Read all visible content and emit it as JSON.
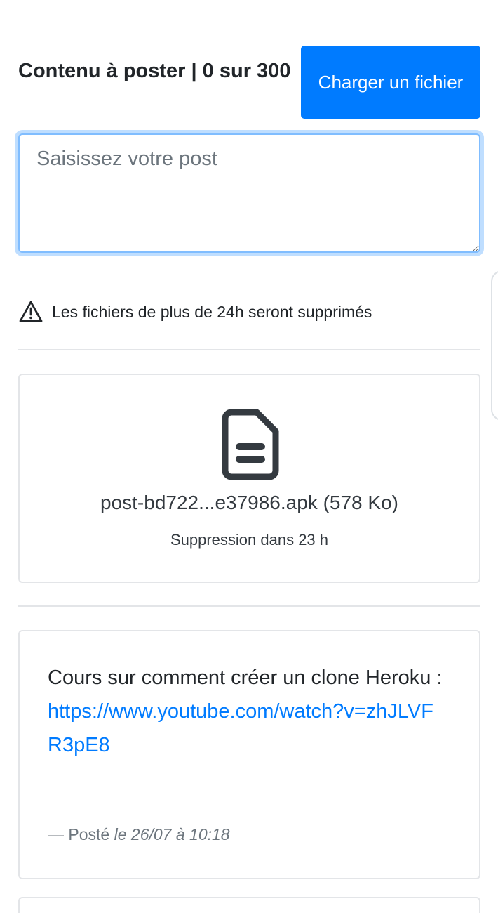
{
  "composer": {
    "counter_text": "Contenu à poster | 0 sur 300",
    "upload_button_label": "Charger un fichier",
    "placeholder": "Saisissez votre post"
  },
  "notice": {
    "icon": "warning-triangle-icon",
    "text": "Les fichiers de plus de 24h seront supprimés"
  },
  "file_post": {
    "icon": "document-icon",
    "name_and_size": "post-bd722...e37986.apk (578 Ko)",
    "expiry": "Suppression dans 23 h"
  },
  "text_post": {
    "body": "Cours sur comment créer un clone Heroku :",
    "link": "https://www.youtube.com/watch?v=zhJLVFR3pE8",
    "meta_prefix": "— Posté",
    "meta_date": "le 26/07 à 10:18"
  },
  "colors": {
    "accent": "#007bff",
    "focus_ring": "#80bdff",
    "text": "#212529",
    "muted": "#6c757d",
    "border": "#e3e5e8"
  }
}
